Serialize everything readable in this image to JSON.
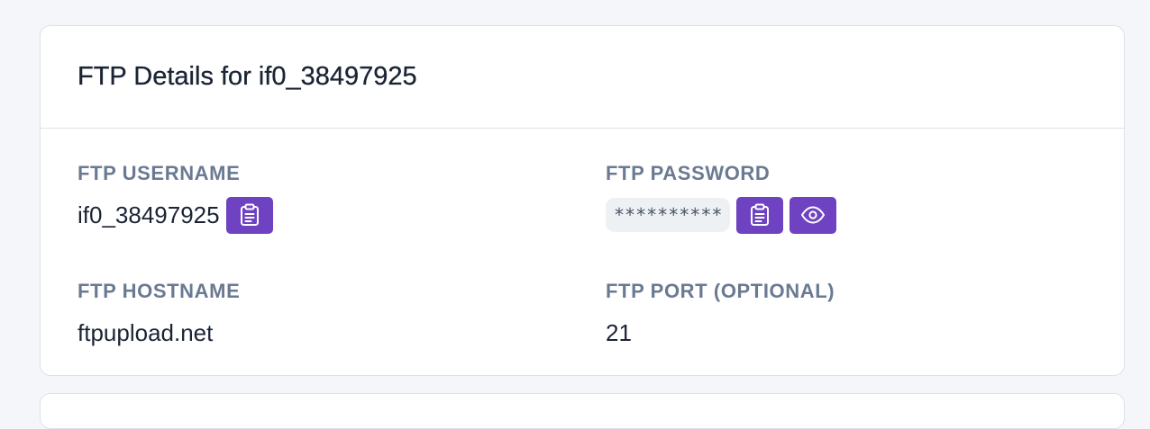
{
  "card": {
    "title": "FTP Details for if0_38497925"
  },
  "fields": {
    "username": {
      "label": "FTP USERNAME",
      "value": "if0_38497925",
      "copy_icon": "clipboard-icon"
    },
    "password": {
      "label": "FTP PASSWORD",
      "value": "**********",
      "copy_icon": "clipboard-icon",
      "reveal_icon": "eye-icon"
    },
    "hostname": {
      "label": "FTP HOSTNAME",
      "value": "ftpupload.net"
    },
    "port": {
      "label": "FTP PORT (OPTIONAL)",
      "value": "21"
    }
  },
  "colors": {
    "accent": "#6f42c1",
    "label": "#6a7a92",
    "text": "#1b2434",
    "background": "#f5f6fa"
  }
}
